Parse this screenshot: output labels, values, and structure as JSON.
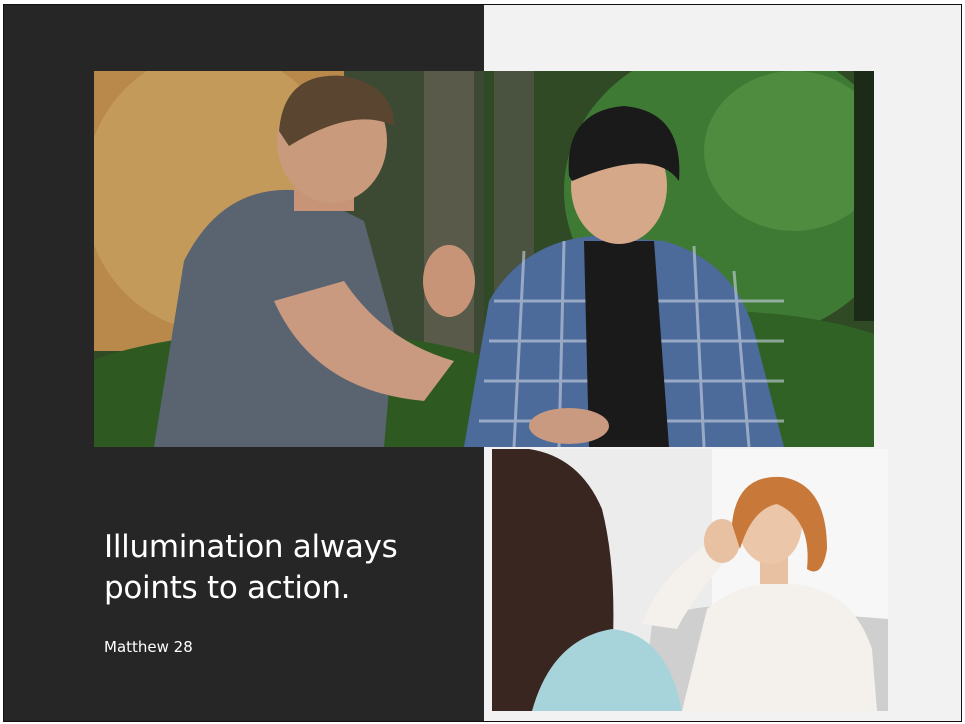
{
  "slide": {
    "title": "Illumination always points to action.",
    "reference": "Matthew 28",
    "colors": {
      "left_panel": "#262626",
      "right_panel": "#f2f2f2",
      "text": "#ffffff"
    }
  },
  "images": {
    "top": "photo-two-men-talking-in-park",
    "bottom": "photo-counseling-session-woman-on-couch"
  }
}
